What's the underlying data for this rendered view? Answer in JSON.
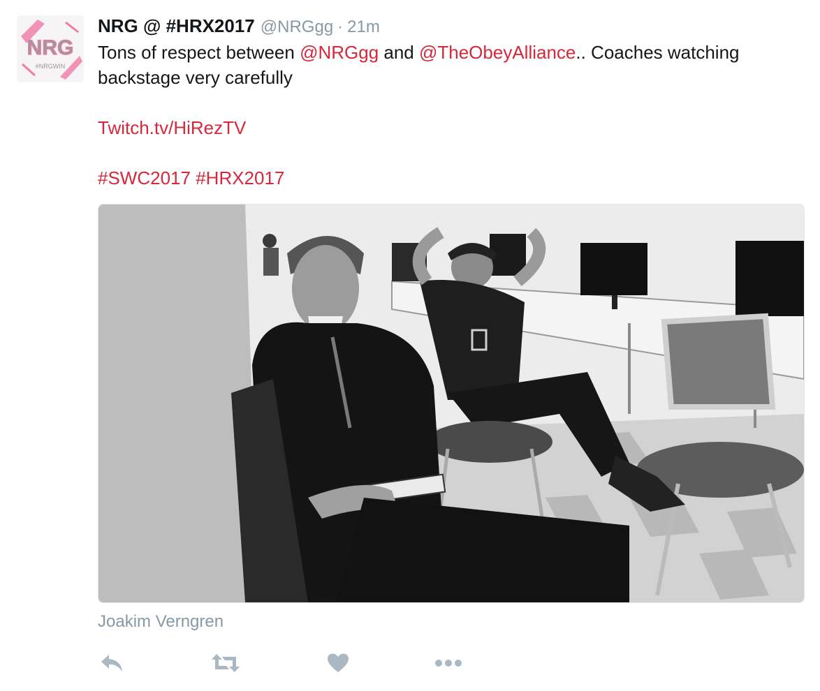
{
  "tweet": {
    "author": {
      "display_name": "NRG @ #HRX2017",
      "screen_name": "@NRGgg",
      "separator": "·",
      "timestamp": "21m",
      "avatar_text": "NRG",
      "avatar_subtext": "#NRGWIN"
    },
    "text": {
      "line1_prefix": "Tons of respect between ",
      "mention1": "@NRGgg",
      "line1_mid": " and ",
      "mention2": "@TheObeyAlliance",
      "line1_suffix": ".. Coaches watching backstage very carefully",
      "link": "Twitch.tv/HiRezTV",
      "hashtag1": "#SWC2017",
      "hashtag2": "#HRX2017"
    },
    "media": {
      "kind": "photo",
      "description_visible": false
    },
    "photo_credit": "Joakim Verngren",
    "actions": {
      "reply_icon": "reply-icon",
      "retweet_icon": "retweet-icon",
      "like_icon": "heart-icon",
      "more_icon": "more-icon"
    }
  },
  "colors": {
    "accent": "#d6283a",
    "muted": "#8899a6",
    "text": "#14171a",
    "icon": "#aab8c2"
  }
}
